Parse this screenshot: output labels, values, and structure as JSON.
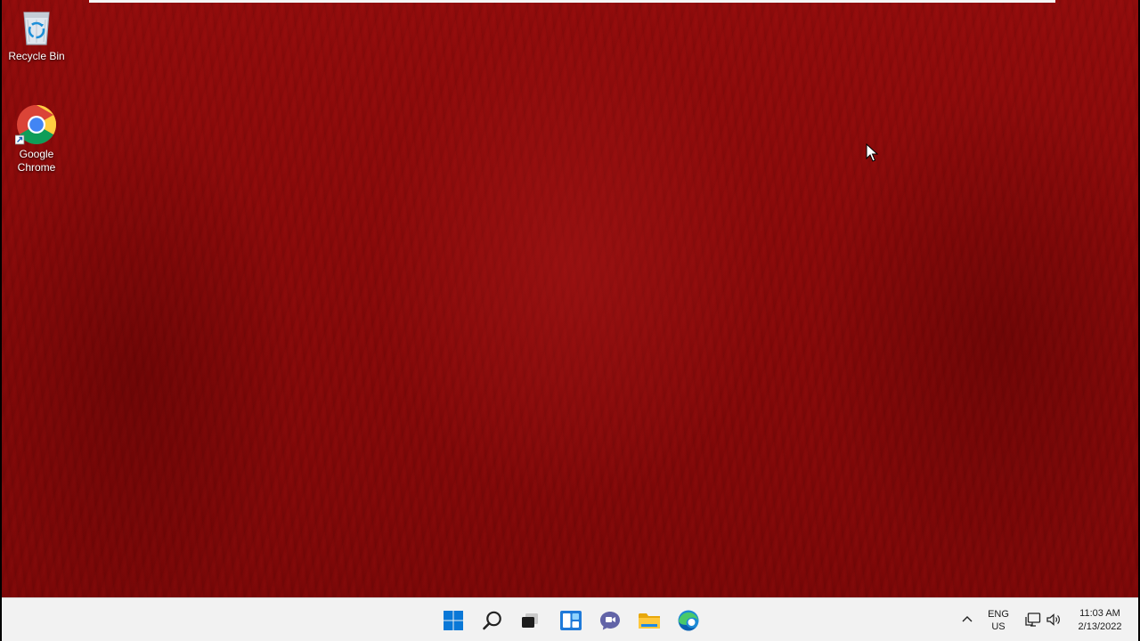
{
  "desktop": {
    "icons": [
      {
        "label": "Recycle Bin",
        "icon": "recycle-bin-icon"
      },
      {
        "label": "Google\nChrome",
        "icon": "chrome-icon"
      }
    ],
    "wallpaper_color": "#870909"
  },
  "taskbar": {
    "background": "#f2f2f2",
    "apps": [
      {
        "name": "Start",
        "icon": "windows-start-icon"
      },
      {
        "name": "Search",
        "icon": "search-icon"
      },
      {
        "name": "Task View",
        "icon": "task-view-icon"
      },
      {
        "name": "Widgets",
        "icon": "widgets-icon"
      },
      {
        "name": "Chat",
        "icon": "chat-icon"
      },
      {
        "name": "File Explorer",
        "icon": "file-explorer-icon"
      },
      {
        "name": "Microsoft Edge",
        "icon": "edge-icon"
      }
    ],
    "tray": {
      "language_line1": "ENG",
      "language_line2": "US",
      "time": "11:03 AM",
      "date": "2/13/2022",
      "icons": [
        "chevron-up-icon",
        "network-icon",
        "volume-icon"
      ]
    }
  }
}
